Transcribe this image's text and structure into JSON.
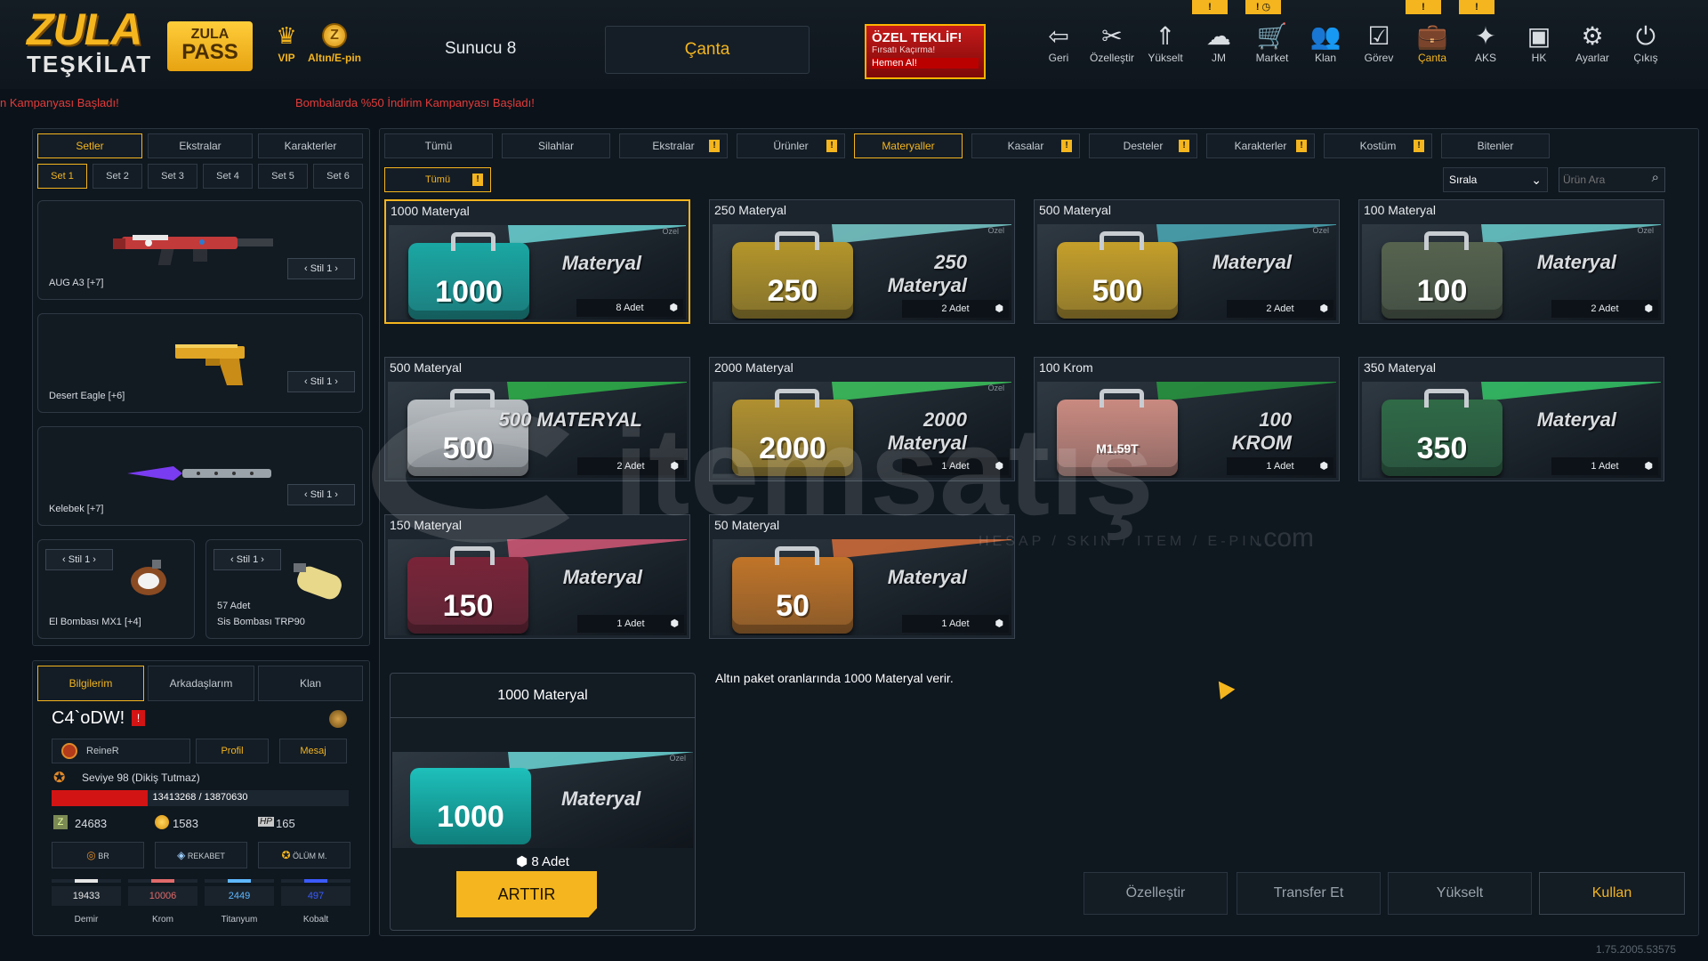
{
  "brand": {
    "logo_line1": "ZULA",
    "logo_line2": "TEŞKİLAT",
    "pass_line1": "ZULA",
    "pass_line2": "PASS"
  },
  "top": {
    "vip_label": "VIP",
    "gold_label": "Altın/E-pin",
    "gold_icon": "Z",
    "server": "Sunucu 8",
    "active_tab": "Çanta",
    "offer": {
      "title": "ÖZEL TEKLİF!",
      "subtitle": "Fırsatı Kaçırma!",
      "cta": "Hemen Al!"
    },
    "nav": [
      {
        "label": "Geri",
        "icon": "⇦"
      },
      {
        "label": "Özelleştir",
        "icon": "✂"
      },
      {
        "label": "Yükselt",
        "icon": "⇑"
      },
      {
        "label": "JM",
        "icon": "☁"
      },
      {
        "label": "Market",
        "icon": "🛒"
      },
      {
        "label": "Klan",
        "icon": "👥"
      },
      {
        "label": "Görev",
        "icon": "☑"
      },
      {
        "label": "Çanta",
        "icon": "💼"
      },
      {
        "label": "AKS",
        "icon": "✦"
      },
      {
        "label": "HK",
        "icon": "▣"
      },
      {
        "label": "Ayarlar",
        "icon": "⚙"
      },
      {
        "label": "Çıkış",
        "icon": "⏻"
      }
    ],
    "warn_badges": [
      "!",
      "! ◷",
      "!",
      "!"
    ]
  },
  "ticker": {
    "left": "n Kampanyası Başladı!",
    "right": "Bombalarda %50 İndirim Kampanyası Başladı!"
  },
  "left": {
    "tabs": [
      "Setler",
      "Ekstralar",
      "Karakterler"
    ],
    "sets": [
      "Set 1",
      "Set 2",
      "Set 3",
      "Set 4",
      "Set 5",
      "Set 6"
    ],
    "slots": [
      {
        "name": "AUG A3 [+7]",
        "stil": "‹  Stil 1  ›"
      },
      {
        "name": "Desert Eagle [+6]",
        "stil": "‹  Stil 1  ›"
      },
      {
        "name": "Kelebek [+7]",
        "stil": "‹  Stil 1  ›"
      }
    ],
    "small_slots": [
      {
        "name": "El Bombası MX1 [+4]",
        "stil": "‹  Stil 1  ›",
        "count": ""
      },
      {
        "name": "Sis Bombası TRP90",
        "stil": "‹  Stil 1  ›",
        "count": "57 Adet"
      }
    ],
    "profile_tabs": [
      "Bilgilerim",
      "Arkadaşlarım",
      "Klan"
    ],
    "username": "C4`oDW!",
    "clan": "ReineR",
    "profil_btn": "Profil",
    "mesaj_btn": "Mesaj",
    "level": "Seviye 98 (Dikiş Tutmaz)",
    "xp": "13413268 / 13870630",
    "xp_progress": 0.967,
    "currencies": {
      "z": "24683",
      "gold": "1583",
      "hp_label": "HP",
      "hp": "165"
    },
    "modes": [
      "BR",
      "REKABET",
      "ÖLÜM M."
    ],
    "materials": [
      {
        "value": "19433",
        "label": "Demir",
        "color": "#e6e6e6"
      },
      {
        "value": "10006",
        "label": "Krom",
        "color": "#e06a6a"
      },
      {
        "value": "2449",
        "label": "Titanyum",
        "color": "#5fb8ff"
      },
      {
        "value": "497",
        "label": "Kobalt",
        "color": "#3b5bff"
      }
    ]
  },
  "main": {
    "categories": [
      {
        "label": "Tümü",
        "warn": false,
        "active": false
      },
      {
        "label": "Silahlar",
        "warn": false,
        "active": false
      },
      {
        "label": "Ekstralar",
        "warn": true,
        "active": false
      },
      {
        "label": "Ürünler",
        "warn": true,
        "active": false
      },
      {
        "label": "Materyaller",
        "warn": false,
        "active": true
      },
      {
        "label": "Kasalar",
        "warn": true,
        "active": false
      },
      {
        "label": "Desteler",
        "warn": true,
        "active": false
      },
      {
        "label": "Karakterler",
        "warn": true,
        "active": false
      },
      {
        "label": "Kostüm",
        "warn": true,
        "active": false
      },
      {
        "label": "Bitenler",
        "warn": false,
        "active": false
      }
    ],
    "subfilter": "Tümü",
    "sort_label": "Sırala",
    "search_placeholder": "Ürün Ara",
    "items": [
      {
        "title": "1000 Materyal",
        "num": "1000",
        "label1": "",
        "label2": "Materyal",
        "qty": "8 Adet",
        "color": "#1aa7a3",
        "stripe": "#6fe0e0",
        "ozel": "Özel"
      },
      {
        "title": "250 Materyal",
        "num": "250",
        "label1": "250",
        "label2": "Materyal",
        "qty": "2 Adet",
        "color": "#b4952a",
        "stripe": "#7fd6d6",
        "ozel": "Özel"
      },
      {
        "title": "500 Materyal",
        "num": "500",
        "label1": "",
        "label2": "Materyal",
        "qty": "2 Adet",
        "color": "#c59f2a",
        "stripe": "#4fb3c0",
        "ozel": "Özel"
      },
      {
        "title": "100 Materyal",
        "num": "100",
        "label1": "",
        "label2": "Materyal",
        "qty": "2 Adet",
        "color": "#56634e",
        "stripe": "#6fd7d7",
        "ozel": "Özel"
      },
      {
        "title": "500 Materyal",
        "num": "500",
        "label1": "",
        "label2": "500 MATERYAL",
        "qty": "2 Adet",
        "color": "#b7bcc0",
        "stripe": "#2fbb4b",
        "ozel": ""
      },
      {
        "title": "2000 Materyal",
        "num": "2000",
        "label1": "2000",
        "label2": "Materyal",
        "qty": "1 Adet",
        "color": "#b09030",
        "stripe": "#3fd060",
        "ozel": "Özel"
      },
      {
        "title": "100 Krom",
        "num": "M1.59T",
        "label1": "100",
        "label2": "KROM",
        "qty": "1 Adet",
        "color": "#c98a80",
        "stripe": "#28a040",
        "ozel": ""
      },
      {
        "title": "350 Materyal",
        "num": "350",
        "label1": "",
        "label2": "Materyal",
        "qty": "1 Adet",
        "color": "#2f6a46",
        "stripe": "#36d06a",
        "ozel": ""
      },
      {
        "title": "150 Materyal",
        "num": "150",
        "label1": "",
        "label2": "Materyal",
        "qty": "1 Adet",
        "color": "#7a2438",
        "stripe": "#e05a7a",
        "ozel": ""
      },
      {
        "title": "50 Materyal",
        "num": "50",
        "label1": "",
        "label2": "Materyal",
        "qty": "1 Adet",
        "color": "#c07428",
        "stripe": "#e0703a",
        "ozel": ""
      }
    ],
    "detail": {
      "title": "1000 Materyal",
      "qty": "8 Adet",
      "button": "ARTTIR",
      "description": "Altın paket oranlarında 1000 Materyal verir.",
      "num": "1000",
      "label": "Materyal",
      "ozel": "Özel"
    },
    "actions": [
      "Özelleştir",
      "Transfer Et",
      "Yükselt",
      "Kullan"
    ],
    "watermark": {
      "text": "itemsatış",
      "sub": "HESAP / SKIN / ITEM / E-PIN",
      "com": ".com"
    },
    "version": "1.75.2005.53575"
  },
  "colors": {
    "accent": "#f4b51e",
    "warn": "#f4b51e",
    "xp_bar": "#d21414",
    "offer_bg": "#b81818"
  }
}
